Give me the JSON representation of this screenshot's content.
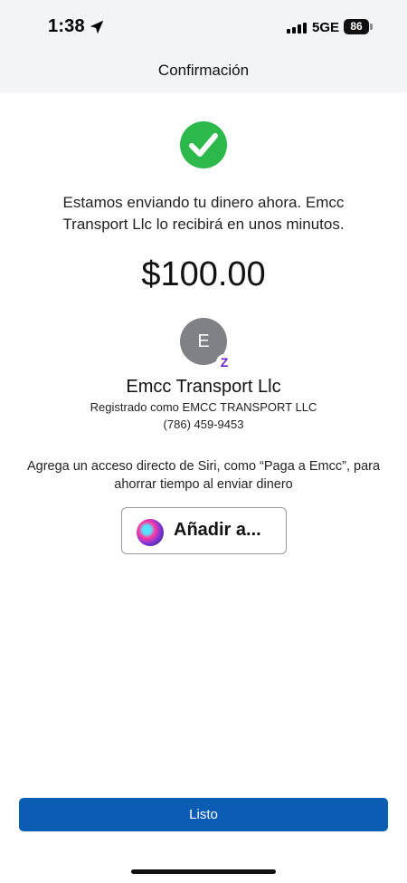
{
  "status_bar": {
    "time": "1:38",
    "network": "5GE",
    "battery": "86",
    "location_icon": "location-arrow-icon",
    "signal_icon": "signal-bars-icon"
  },
  "header": {
    "title": "Confirmación"
  },
  "confirmation": {
    "icon": "check-circle-icon",
    "accent_color": "#2db84b",
    "message": "Estamos enviando tu dinero ahora. Emcc Transport Llc lo recibirá en unos minutos.",
    "amount": "$100.00"
  },
  "recipient": {
    "initial": "E",
    "badge_icon": "zelle-icon",
    "badge_text": "Z",
    "name": "Emcc Transport Llc",
    "registered_as": "Registrado como EMCC TRANSPORT LLC",
    "phone": "(786) 459-9453"
  },
  "siri": {
    "prompt": "Agrega un acceso directo de Siri, como “Paga a Emcc”, para ahorrar tiempo al enviar dinero",
    "button_label": "Añadir a...",
    "icon": "siri-icon"
  },
  "footer": {
    "done_label": "Listo",
    "done_color": "#0b5cb3"
  }
}
